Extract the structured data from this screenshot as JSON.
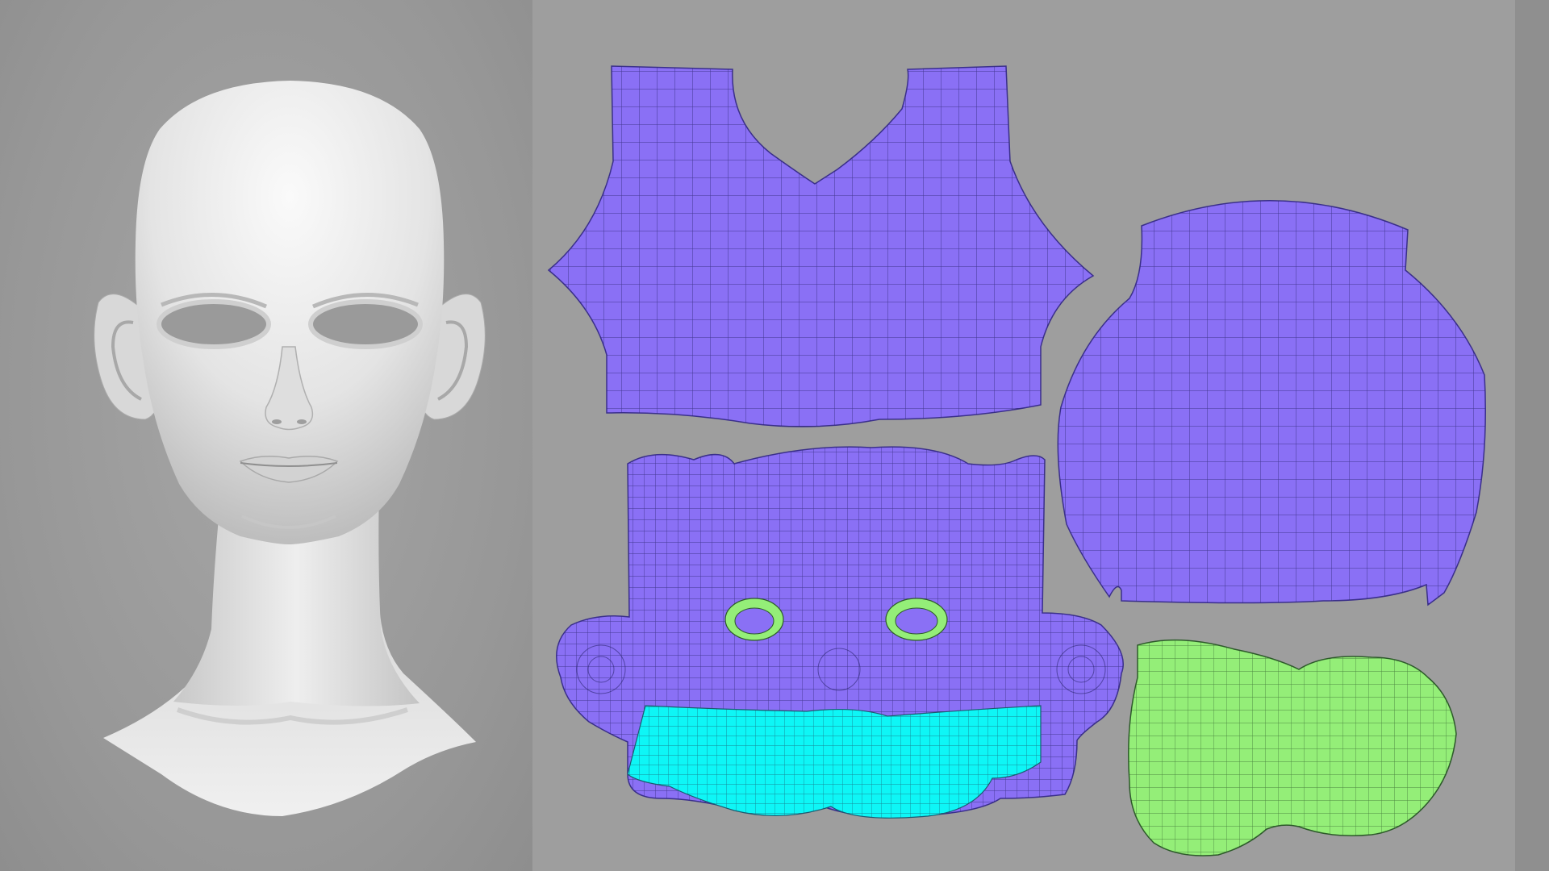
{
  "colors": {
    "background_left": "#9a9a9a",
    "background_right": "#9e9e9e",
    "uv_shell_purple": "#8a70f5",
    "uv_shell_cyan": "#0ef6f6",
    "uv_shell_green": "#94ee78",
    "wire": "#2b2470",
    "head_skin": "#e6e6e6"
  },
  "uv_shells": [
    {
      "name": "torso",
      "color": "purple"
    },
    {
      "name": "scalp",
      "color": "purple"
    },
    {
      "name": "face",
      "color": "purple"
    },
    {
      "name": "mouth-region",
      "color": "cyan"
    },
    {
      "name": "eye-rims",
      "color": "green"
    },
    {
      "name": "inner-mouth",
      "color": "green"
    }
  ]
}
